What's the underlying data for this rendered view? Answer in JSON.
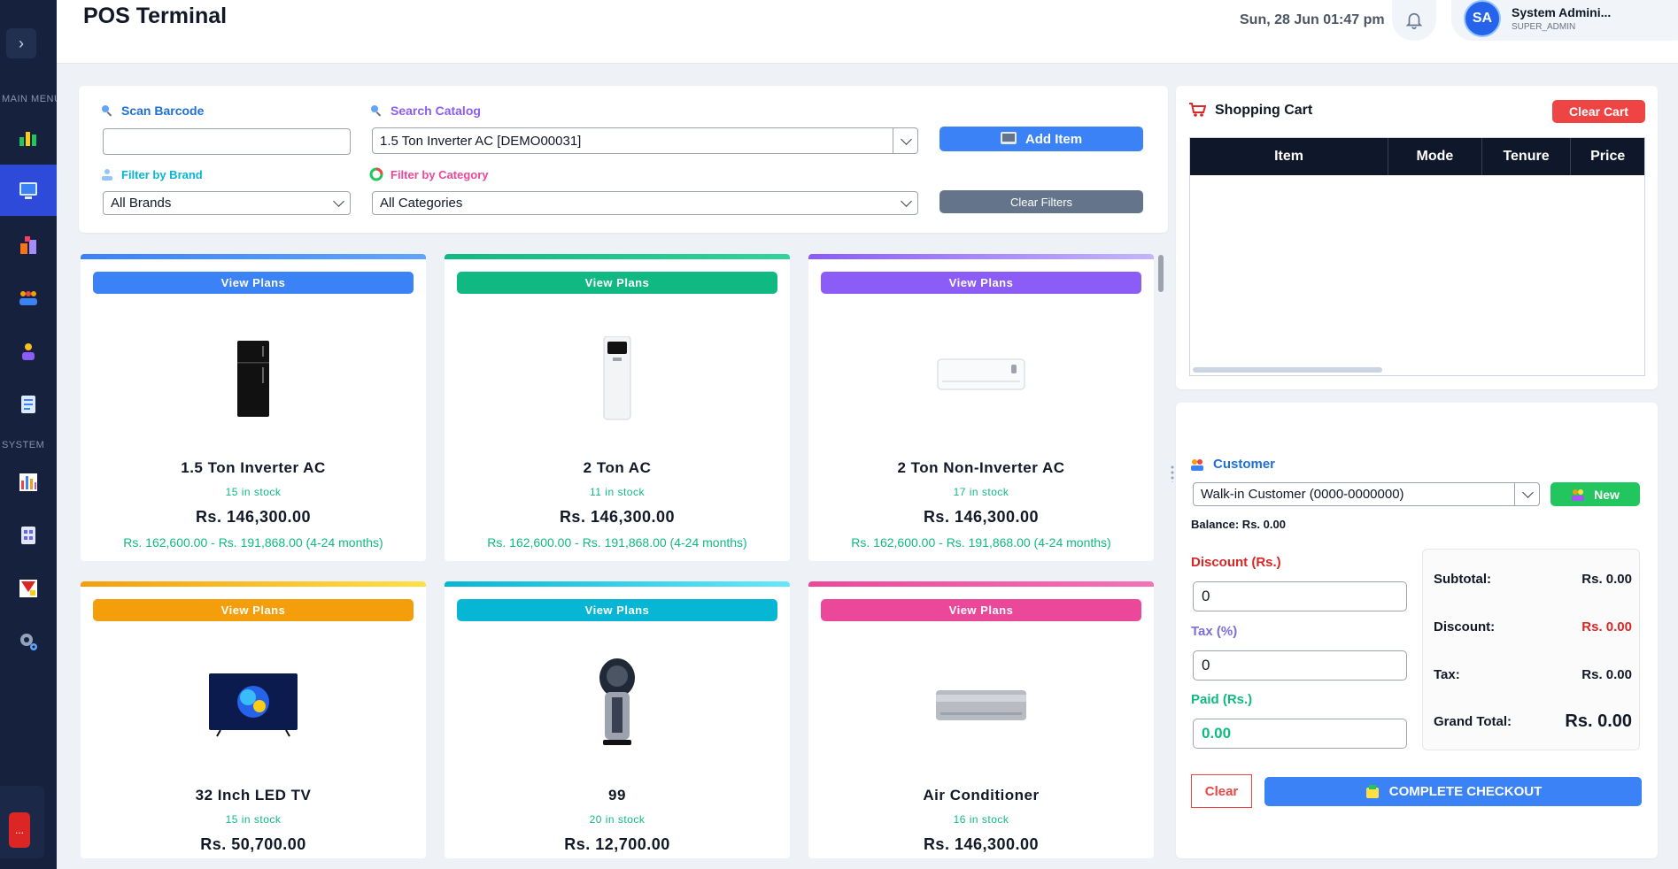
{
  "sidebar": {
    "toggle_glyph": "›",
    "section_main": "MAIN MENU",
    "section_system": "SYSTEM",
    "logout_glyph": "...",
    "icon_colors": [
      "#22c55e",
      "#60a5fa",
      "#f97316",
      "#f59e0b",
      "#a78bfa",
      "#93c5fd",
      "#f43f5e",
      "#cbd5e1",
      "#ef4444",
      "#94a3b8"
    ]
  },
  "header": {
    "title": "POS Terminal",
    "datetime": "Sun, 28 Jun  01:47 pm",
    "user": {
      "initials": "SA",
      "name": "System Admini...",
      "role": "SUPER_ADMIN"
    }
  },
  "filters": {
    "scan_label": "Scan Barcode",
    "scan_value": "",
    "search_label": "Search Catalog",
    "search_value": "1.5 Ton Inverter AC [DEMO00031]",
    "add_item_label": "Add Item",
    "brand_label": "Filter by Brand",
    "brand_value": "All Brands",
    "category_label": "Filter by Category",
    "category_value": "All Categories",
    "clear_filters_label": "Clear Filters"
  },
  "products": [
    {
      "name": "1.5 Ton Inverter AC",
      "stock": "15 in stock",
      "price": "Rs. 146,300.00",
      "range": "Rs. 162,600.00 - Rs. 191,868.00 (4-24 months)",
      "plans": "View Plans",
      "color": "#3b82f6",
      "image": "fridge"
    },
    {
      "name": "2 Ton AC",
      "stock": "11 in stock",
      "price": "Rs. 146,300.00",
      "range": "Rs. 162,600.00 - Rs. 191,868.00 (4-24 months)",
      "plans": "View Plans",
      "color": "#10b981",
      "image": "floor-ac"
    },
    {
      "name": "2 Ton Non-Inverter AC",
      "stock": "17 in stock",
      "price": "Rs. 146,300.00",
      "range": "Rs. 162,600.00 - Rs. 191,868.00 (4-24 months)",
      "plans": "View Plans",
      "color": "#8b5cf6",
      "image": "split-ac"
    },
    {
      "name": "32 Inch LED TV",
      "stock": "15 in stock",
      "price": "Rs. 50,700.00",
      "range": "",
      "plans": "View Plans",
      "color": "#f59e0b",
      "image": "tv"
    },
    {
      "name": "99",
      "stock": "20 in stock",
      "price": "Rs. 12,700.00",
      "range": "",
      "plans": "View Plans",
      "color": "#06b6d4",
      "image": "air-cooler"
    },
    {
      "name": "Air Conditioner",
      "stock": "16 in stock",
      "price": "Rs. 146,300.00",
      "range": "",
      "plans": "View Plans",
      "color": "#ec4899",
      "image": "split-ac-silver"
    }
  ],
  "cart": {
    "title": "Shopping Cart",
    "clear_label": "Clear Cart",
    "columns": [
      "Item",
      "Mode",
      "Tenure",
      "Price"
    ]
  },
  "checkout": {
    "customer_label": "Customer",
    "customer_value": "Walk-in Customer (0000-0000000)",
    "new_label": "New",
    "balance": "Balance: Rs. 0.00",
    "discount_label": "Discount (Rs.)",
    "discount_value": "0",
    "tax_label": "Tax (%)",
    "tax_value": "0",
    "paid_label": "Paid (Rs.)",
    "paid_value": "0.00",
    "summary": {
      "subtotal_label": "Subtotal:",
      "subtotal_value": "Rs. 0.00",
      "discount_label": "Discount:",
      "discount_value": "Rs. 0.00",
      "tax_label": "Tax:",
      "tax_value": "Rs. 0.00",
      "grand_label": "Grand Total:",
      "grand_value": "Rs. 0.00"
    },
    "clear_label": "Clear",
    "complete_label": "COMPLETE CHECKOUT"
  }
}
